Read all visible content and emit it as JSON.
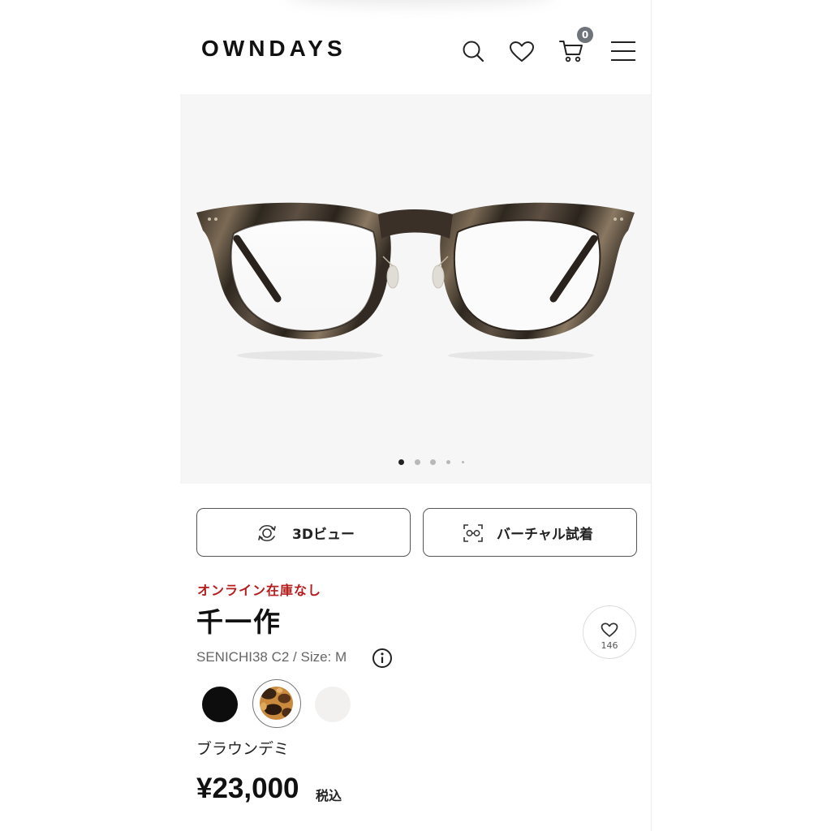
{
  "header": {
    "logo": "OWNDAYS",
    "icons": [
      "search-icon",
      "heart-icon",
      "cart-icon",
      "menu-icon"
    ],
    "cart_count": "0"
  },
  "gallery": {
    "image": "glasses-product-image",
    "active_index": 1,
    "total": 5
  },
  "actions": {
    "view_3d": "3Dビュー",
    "virtual_tryon": "バーチャル試着"
  },
  "product": {
    "stock_status": "オンライン在庫なし",
    "name": "千一作",
    "model": "SENICHI38 C2  / Size: M",
    "favorite_count": "146",
    "colors": [
      {
        "name": "black",
        "hex": "#0d0d0d"
      },
      {
        "name": "brown-demi",
        "hex": "#8a5a2b"
      },
      {
        "name": "clear",
        "hex": "#f2f1ef"
      }
    ],
    "selected_color_name": "ブラウンデミ",
    "price": "¥23,000",
    "tax_label": "税込"
  },
  "colors": {
    "stock_red": "#b71c1c",
    "badge_gray": "#6e7479",
    "hero_bg": "#f6f6f6"
  }
}
